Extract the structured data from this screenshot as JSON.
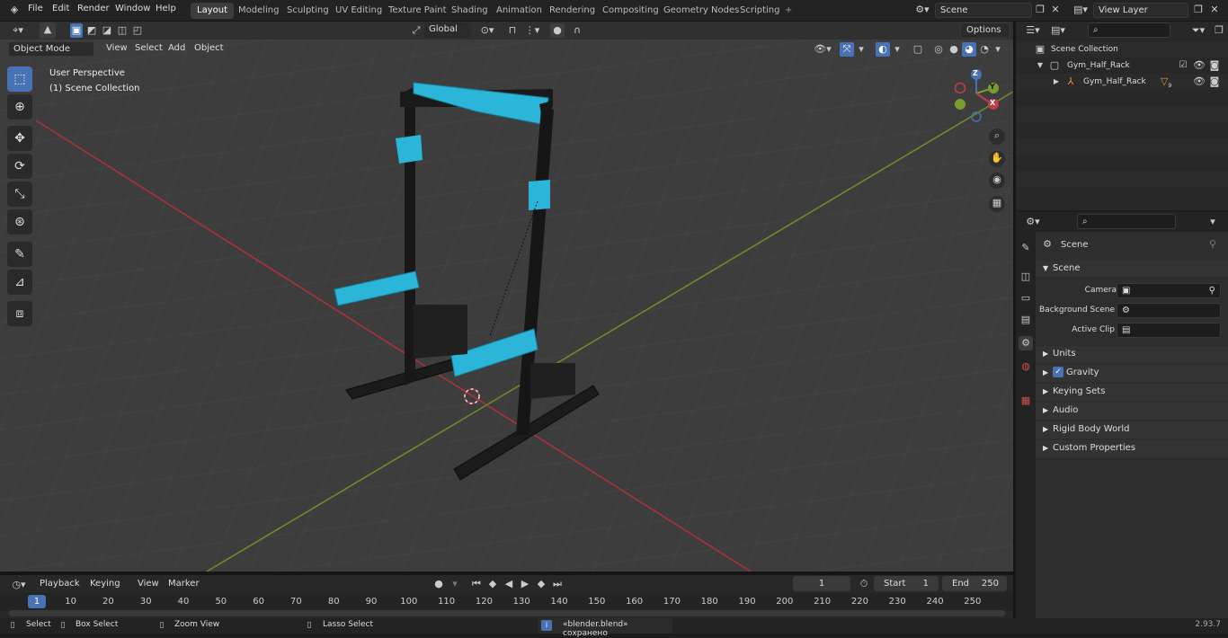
{
  "topbar": {
    "menus": [
      "File",
      "Edit",
      "Render",
      "Window",
      "Help"
    ],
    "workspaces": [
      "Layout",
      "Modeling",
      "Sculpting",
      "UV Editing",
      "Texture Paint",
      "Shading",
      "Animation",
      "Rendering",
      "Compositing",
      "Geometry Nodes",
      "Scripting"
    ],
    "active_workspace": "Layout",
    "add_tab": "+",
    "scene_name": "Scene",
    "view_layer": "View Layer"
  },
  "viewport": {
    "mode": "Object Mode",
    "menus": [
      "View",
      "Select",
      "Add",
      "Object"
    ],
    "transform_orientation": "Global",
    "options_label": "Options",
    "perspective_label": "User Perspective",
    "collection_label": "(1) Scene Collection",
    "gizmo": {
      "x": "X",
      "y": "Y",
      "z": "Z"
    }
  },
  "outliner": {
    "root": "Scene Collection",
    "items": [
      {
        "label": "Gym_Half_Rack",
        "indent": 1
      },
      {
        "label": "Gym_Half_Rack",
        "indent": 2,
        "badge": "9"
      }
    ]
  },
  "properties": {
    "header": "Scene",
    "section": "Scene",
    "fields": [
      {
        "label": "Camera",
        "value": ""
      },
      {
        "label": "Background Scene",
        "value": ""
      },
      {
        "label": "Active Clip",
        "value": ""
      }
    ],
    "subpanels": [
      "Units",
      "Gravity",
      "Keying Sets",
      "Audio",
      "Rigid Body World",
      "Custom Properties"
    ],
    "gravity_checked": true
  },
  "timeline": {
    "menus": [
      "Playback",
      "Keying",
      "View",
      "Marker"
    ],
    "current_frame": "1",
    "start_label": "Start",
    "start_value": "1",
    "end_label": "End",
    "end_value": "250",
    "ruler": [
      "1",
      "10",
      "20",
      "30",
      "40",
      "50",
      "60",
      "70",
      "80",
      "90",
      "100",
      "110",
      "120",
      "130",
      "140",
      "150",
      "160",
      "170",
      "180",
      "190",
      "200",
      "210",
      "220",
      "230",
      "240",
      "250"
    ]
  },
  "statusbar": {
    "select": "Select",
    "box_select": "Box Select",
    "zoom_view": "Zoom View",
    "lasso_select": "Lasso Select",
    "message": "«blender.blend» сохранено",
    "version": "2.93.7"
  },
  "colors": {
    "accent": "#4772b3",
    "model_cyan": "#2bb5d8",
    "x_axis": "#c33d47",
    "y_axis": "#7a9c2a"
  }
}
